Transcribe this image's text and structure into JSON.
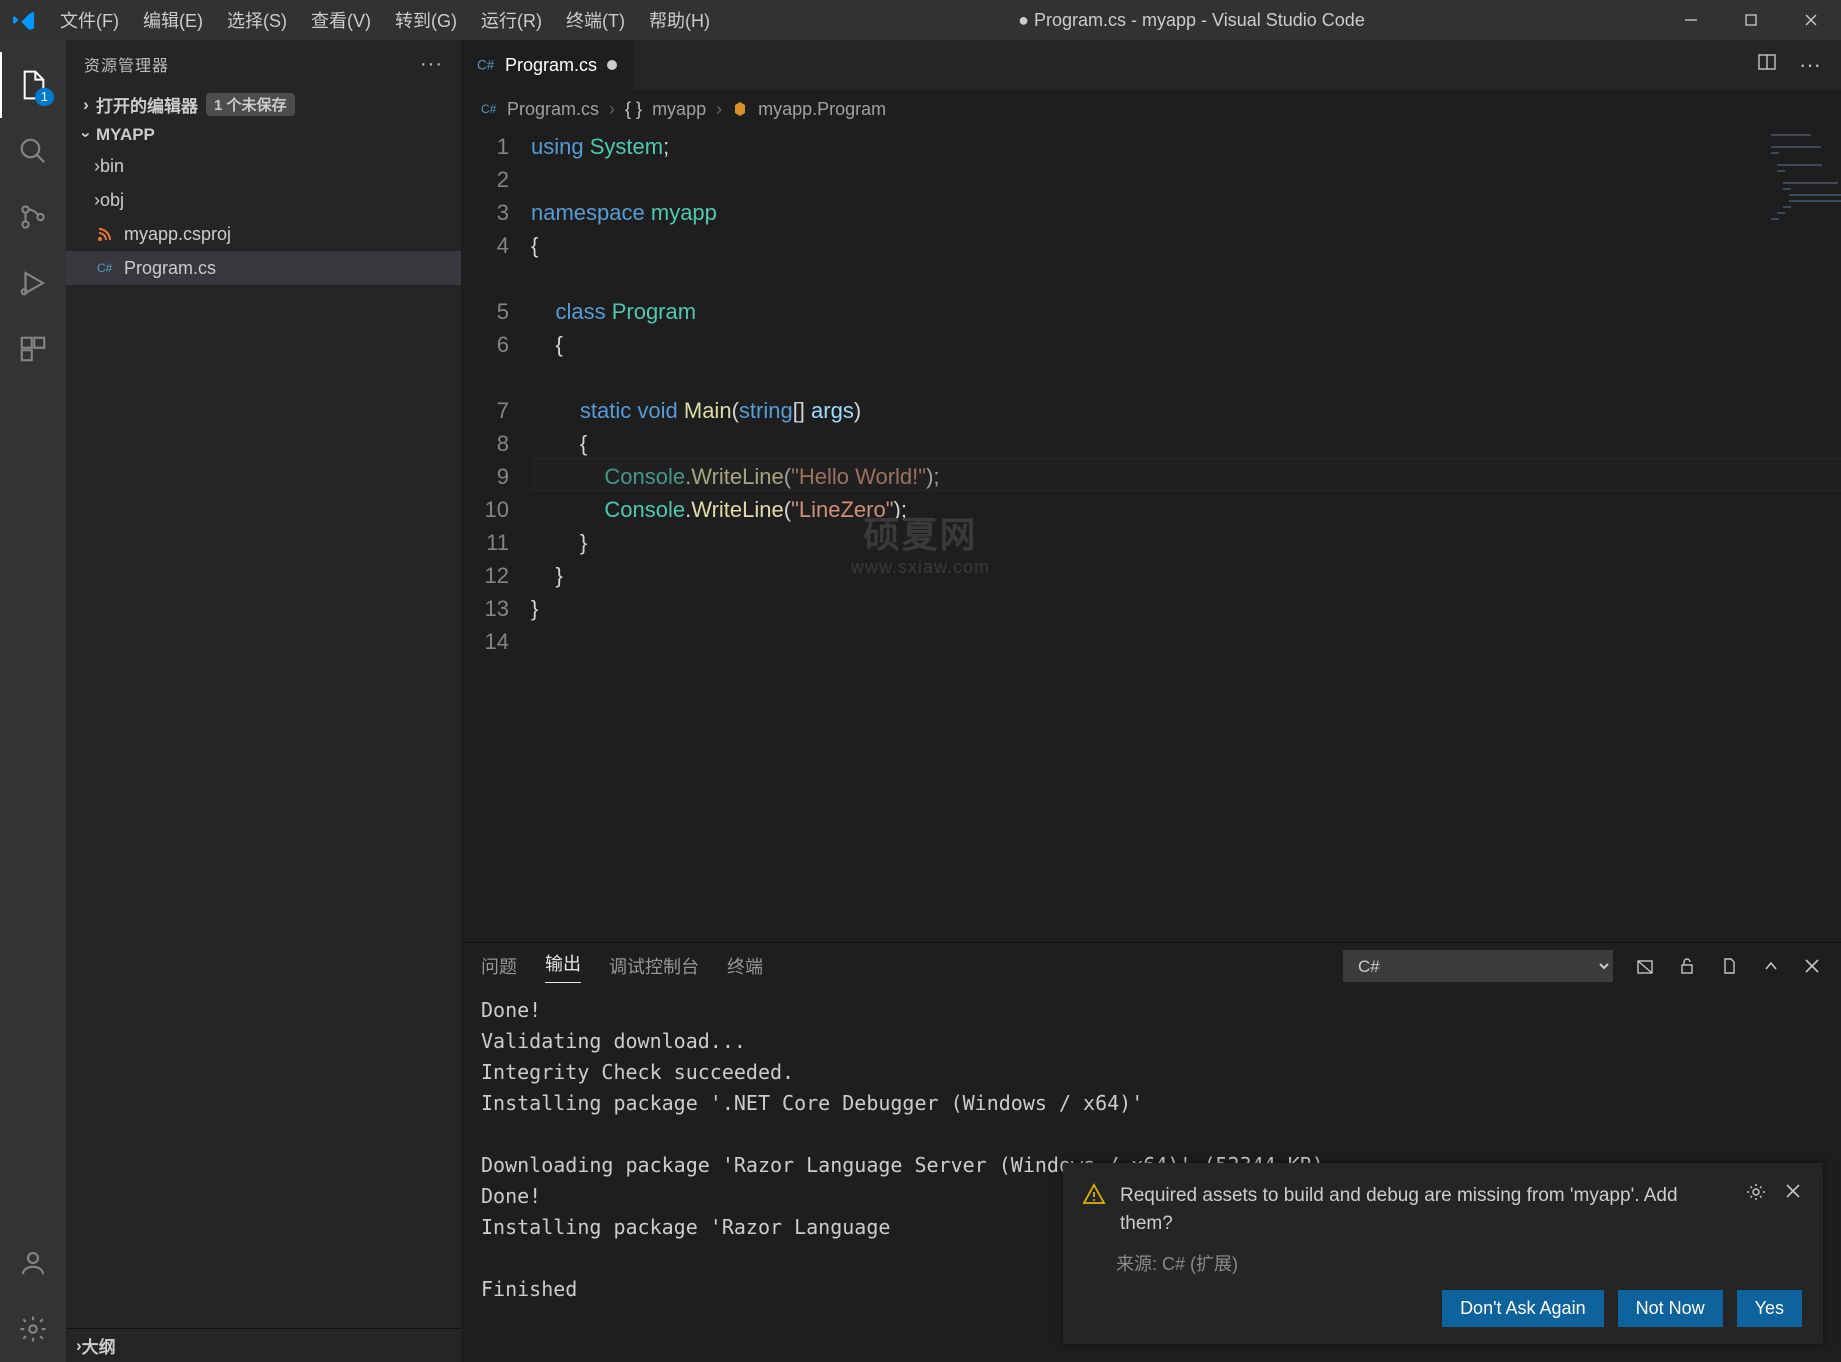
{
  "window": {
    "title_prefix": "●",
    "title": "Program.cs - myapp - Visual Studio Code"
  },
  "menubar": [
    "文件(F)",
    "编辑(E)",
    "选择(S)",
    "查看(V)",
    "转到(G)",
    "运行(R)",
    "终端(T)",
    "帮助(H)"
  ],
  "activitybar": {
    "explorer_badge": "1"
  },
  "sidebar": {
    "title": "资源管理器",
    "open_editors_label": "打开的编辑器",
    "unsaved_label": "1 个未保存",
    "project": "MYAPP",
    "tree": [
      {
        "kind": "folder",
        "label": "bin"
      },
      {
        "kind": "folder",
        "label": "obj"
      },
      {
        "kind": "csproj",
        "label": "myapp.csproj"
      },
      {
        "kind": "cs",
        "label": "Program.cs",
        "selected": true
      }
    ],
    "outline_label": "大纲"
  },
  "tabs": {
    "active": {
      "label": "Program.cs",
      "dirty": true
    }
  },
  "breadcrumb": [
    "Program.cs",
    "myapp",
    "myapp.Program"
  ],
  "code": {
    "line_numbers": [
      1,
      2,
      3,
      4,
      5,
      6,
      7,
      8,
      9,
      10,
      11,
      12,
      13,
      14
    ],
    "highlight_line": 10,
    "lines": {
      "l1": {
        "using": "using",
        "system": "System"
      },
      "l3": {
        "namespace": "namespace",
        "name": "myapp"
      },
      "l6": {
        "class": "class",
        "name": "Program"
      },
      "l8": {
        "static": "static",
        "void": "void",
        "main": "Main",
        "string": "string",
        "args": "args"
      },
      "l10": {
        "cls": "Console",
        "fn": "WriteLine",
        "str": "\"Hello World!\""
      },
      "l11": {
        "cls": "Console",
        "fn": "WriteLine",
        "str": "\"LineZero\""
      }
    }
  },
  "watermark": {
    "big": "硕夏网",
    "small": "www.sxiaw.com"
  },
  "panel": {
    "tabs": [
      "问题",
      "输出",
      "调试控制台",
      "终端"
    ],
    "active_tab": 1,
    "filter": "C#",
    "output": "Done!\nValidating download...\nIntegrity Check succeeded.\nInstalling package '.NET Core Debugger (Windows / x64)'\n\nDownloading package 'Razor Language Server (Windows / x64)' (52344 KB)....................\nDone!\nInstalling package 'Razor Language\n\nFinished"
  },
  "notification": {
    "message": "Required assets to build and debug are missing from 'myapp'. Add them?",
    "source": "来源: C# (扩展)",
    "buttons": [
      "Don't Ask Again",
      "Not Now",
      "Yes"
    ]
  }
}
